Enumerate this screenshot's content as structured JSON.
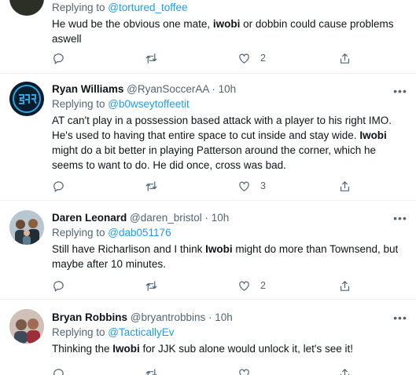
{
  "tweets": [
    {
      "name": "",
      "handle_time": "",
      "replying_prefix": "Replying to ",
      "replying_handle": "@tortured_toffee",
      "text_parts": [
        "He wud be the obvious one mate, ",
        "iwobi",
        " or dobbin could cause problems aswell"
      ],
      "likes": "2"
    },
    {
      "name": "Ryan Williams",
      "handle_time": " @RyanSoccerAA · 10h",
      "replying_prefix": "Replying to ",
      "replying_handle": "@b0wseytoffeetit",
      "text_parts": [
        "AT can't play in a possession based attack with a player to his right IMO. He's used to having that entire space to cut inside and stay wide.  ",
        "Iwobi",
        " might do a bit better in playing Patterson around the corner, which he seems to want to do.  He did once, cross was bad."
      ],
      "likes": "3"
    },
    {
      "name": "Daren Leonard",
      "handle_time": " @daren_bristol · 10h",
      "replying_prefix": "Replying to ",
      "replying_handle": "@dab051176",
      "text_parts": [
        "Still have Richarlison and I think ",
        "Iwobi",
        " might do more than Townsend, but maybe after 10 minutes."
      ],
      "likes": "2"
    },
    {
      "name": "Bryan Robbins",
      "handle_time": " @bryantrobbins · 10h",
      "replying_prefix": "Replying to ",
      "replying_handle": "@TacticallyEv",
      "text_parts": [
        "Thinking the ",
        "Iwobi",
        " for JJK sub alone would unlock it, let's see it!"
      ],
      "likes": ""
    }
  ],
  "more_glyph": "•••",
  "colors": {
    "link": "#1d9bf0",
    "muted": "#536471",
    "text": "#0f1419",
    "divider": "#eff3f4"
  },
  "icons": [
    "reply-icon",
    "retweet-icon",
    "like-icon",
    "share-icon",
    "more-icon"
  ]
}
